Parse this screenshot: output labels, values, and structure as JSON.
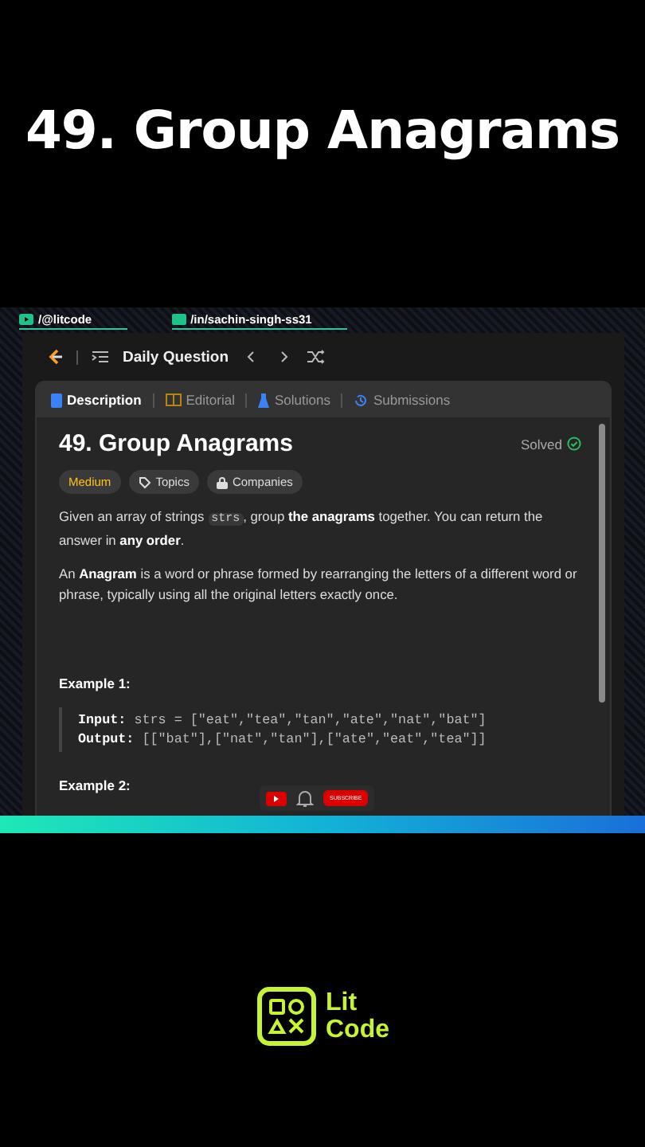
{
  "headline": "49. Group Anagrams",
  "handles": [
    {
      "kind": "youtube",
      "text": "/@litcode"
    },
    {
      "kind": "linkedin",
      "text": "/in/sachin-singh-ss31"
    }
  ],
  "nav": {
    "title": "Daily Question"
  },
  "tabs": [
    {
      "kind": "description",
      "label": "Description",
      "selected": true
    },
    {
      "kind": "editorial",
      "label": "Editorial",
      "selected": false
    },
    {
      "kind": "solutions",
      "label": "Solutions",
      "selected": false
    },
    {
      "kind": "submissions",
      "label": "Submissions",
      "selected": false
    }
  ],
  "problem": {
    "title": "49. Group Anagrams",
    "status": "Solved",
    "tags": [
      {
        "kind": "difficulty",
        "label": "Medium"
      },
      {
        "kind": "topics",
        "label": "Topics"
      },
      {
        "kind": "companies",
        "label": "Companies"
      }
    ],
    "paragraphs": [
      [
        {
          "kind": "text",
          "text": "Given an array of strings "
        },
        {
          "kind": "code",
          "text": "strs"
        },
        {
          "kind": "text",
          "text": ", group **the anagrams** together. You can return the answer in **any order**."
        }
      ],
      [
        {
          "kind": "text",
          "text": "An **Anagram** is a word or phrase formed by rearranging the letters of a different word or phrase, typically using all the original letters exactly once."
        }
      ]
    ],
    "examples": [
      {
        "title": "Example 1:",
        "lines": [
          {
            "label": "Input:",
            "value": "strs = [\"eat\",\"tea\",\"tan\",\"ate\",\"nat\",\"bat\"]"
          },
          {
            "label": "Output:",
            "value": "[[\"bat\"],[\"nat\",\"tan\"],[\"ate\",\"eat\",\"tea\"]]"
          }
        ]
      },
      {
        "title": "Example 2:"
      }
    ]
  },
  "subscribe": {
    "label": "SUBSCRIBE"
  },
  "logo": {
    "line1": "Lit",
    "line2": "Code"
  }
}
